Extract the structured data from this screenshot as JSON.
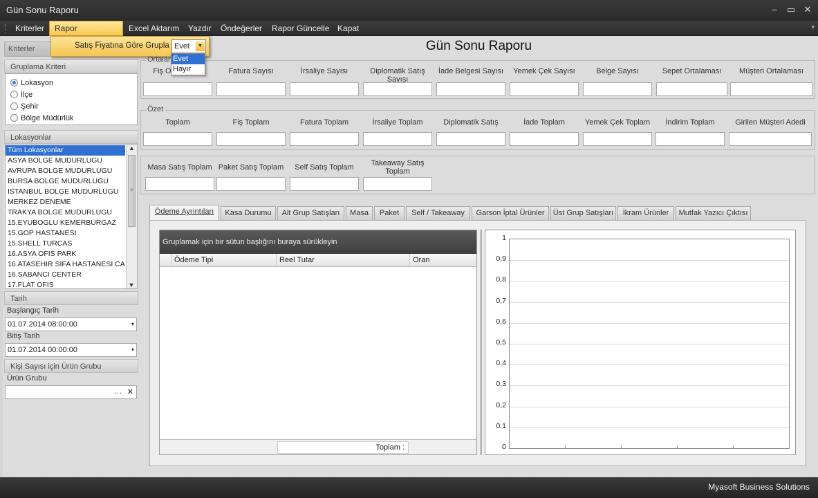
{
  "window": {
    "title": "Gün Sonu Raporu"
  },
  "menu": {
    "items": [
      "Kriterler",
      "Rapor Seçenekleri",
      "Excel Aktarım",
      "Yazdır",
      "Öndeğerler",
      "Rapor Güncelle",
      "Kapat"
    ],
    "active_index": 1
  },
  "popup": {
    "label": "Satış Fiyatına Göre Grupla",
    "selected": "Evet",
    "options": [
      "Evet",
      "Hayır"
    ]
  },
  "left": {
    "kriterler_label": "Kriterler",
    "gruplama": {
      "title": "Gruplama Kriteri",
      "options": [
        "Lokasyon",
        "İlçe",
        "Şehir",
        "Bölge Müdürlük"
      ],
      "selected_index": 0
    },
    "lokasyonlar": {
      "title": "Lokasyonlar",
      "items": [
        "Tüm Lokasyonlar",
        "ASYA BOLGE MUDURLUGU",
        "AVRUPA BOLGE MUDURLUGU",
        "BURSA BOLGE MUDURLUGU",
        "ISTANBUL BOLGE MUDURLUGU",
        "MERKEZ DENEME",
        "TRAKYA BOLGE MUDURLUGU",
        "15.EYUBOGLU KEMERBURGAZ",
        "15.GOP HASTANESI",
        "15.SHELL TURCAS",
        "16.ASYA OFIS PARK",
        "16.ATASEHIR SIFA HASTANESI CA",
        "16.SABANCI CENTER",
        "17.FLAT OFIS"
      ]
    },
    "tarih": {
      "title": "Tarih",
      "start_label": "Başlangıç Tarih",
      "start_value": "01.07.2014 08:00:00",
      "end_label": "Bitiş Tarih",
      "end_value": "01.07.2014 00:00:00"
    },
    "urun": {
      "title": "Kişi Sayısı için Ürün Grubu",
      "field_label": "Ürün Grubu",
      "ellipsis": "...",
      "clear": "✕"
    }
  },
  "main": {
    "title": "Gün Sonu Raporu",
    "ortalama": {
      "title": "Ortalama",
      "columns": [
        "Fiş Ortalaması",
        "Fatura Sayısı",
        "İrsaliye Sayısı",
        "Diplomatik Satış Sayısı",
        "İade Belgesi Sayısı",
        "Yemek Çek Sayısı",
        "Belge Sayısı",
        "Sepet Ortalaması",
        "Müşteri Ortalaması"
      ]
    },
    "ozet": {
      "title": "Özet",
      "columns": [
        "Toplam",
        "Fiş Toplam",
        "Fatura Toplam",
        "İrsaliye Toplam",
        "Diplomatik Satış",
        "İade Toplam",
        "Yemek Çek Toplam",
        "İndirim Toplam",
        "Girilen Müşteri Adedi"
      ]
    },
    "satis": {
      "columns": [
        "Masa Satış Toplam",
        "Paket Satış Toplam",
        "Self Satış Toplam",
        "Takeaway Satış Toplam"
      ]
    },
    "tabs": [
      "Ödeme Ayrıntıları",
      "Kasa Durumu",
      "Alt Grup Satışları",
      "Masa",
      "Paket",
      "Self / Takeaway",
      "Garson İptal Ürünler",
      "Üst Grup Satışları",
      "İkram Ürünler",
      "Mutfak Yazıcı Çıktısı"
    ],
    "active_tab": 0,
    "grid": {
      "group_hint": "Gruplamak için bir sütun başlığını buraya sürükleyin",
      "columns": [
        "Ödeme Tipi",
        "Reel Tutar",
        "Oran"
      ],
      "footer_label": "Toplam :"
    },
    "chart_axis_labels": [
      "1",
      "0,9",
      "0,8",
      "0,7",
      "0,6",
      "0,5",
      "0,4",
      "0,3",
      "0,2",
      "0,1",
      "0"
    ]
  },
  "status": {
    "text": "Myasoft Business Solutions"
  },
  "colors": {
    "menu_active": "#f9c850",
    "selection": "#3070d0",
    "dark_chrome": "#2b2b2b"
  }
}
